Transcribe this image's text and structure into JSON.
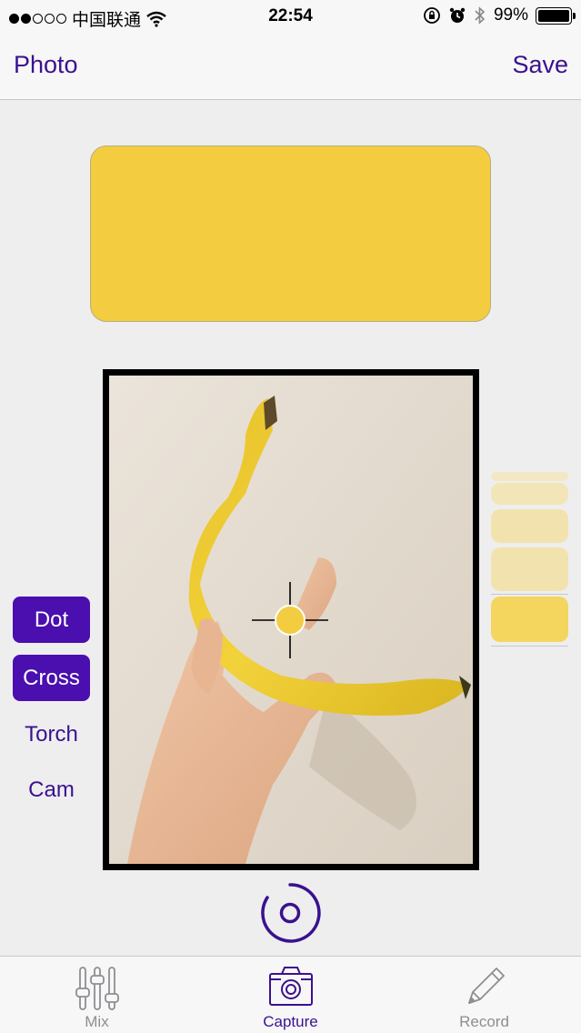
{
  "status_bar": {
    "carrier": "中国联通",
    "time": "22:54",
    "battery": "99%"
  },
  "nav": {
    "left_label": "Photo",
    "right_label": "Save"
  },
  "selected_color": "#f4cc40",
  "accent_color": "#3a118f",
  "button_color": "#4a0fae",
  "modes": {
    "dot": "Dot",
    "cross": "Cross",
    "torch": "Torch",
    "cam": "Cam"
  },
  "history_colors": [
    "#f2e9c4",
    "#f2e5b8",
    "#f2e3ae",
    "#f2e3ae",
    "#f4d55e"
  ],
  "tabs": {
    "mix": "Mix",
    "capture": "Capture",
    "record": "Record"
  }
}
